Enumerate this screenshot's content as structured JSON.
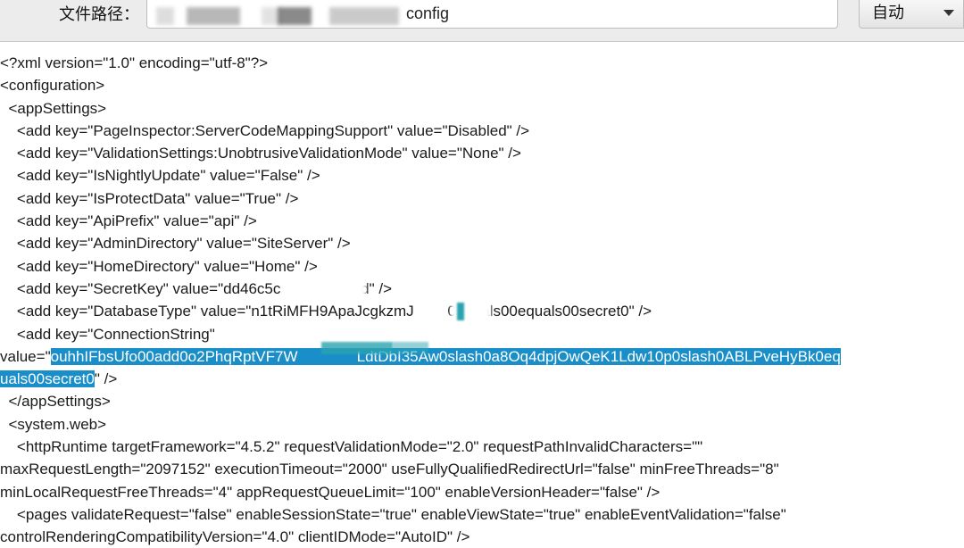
{
  "toolbar": {
    "path_label": "文件路径：",
    "path_value_visible": "config",
    "encoding_value": "自动",
    "chevron_icon": "chevron-down-icon"
  },
  "code_lines": [
    "<?xml version=\"1.0\" encoding=\"utf-8\"?>",
    "<configuration>",
    "  <appSettings>",
    "    <add key=\"PageInspector:ServerCodeMappingSupport\" value=\"Disabled\" />",
    "    <add key=\"ValidationSettings:UnobtrusiveValidationMode\" value=\"None\" />",
    "    <add key=\"IsNightlyUpdate\" value=\"False\" />",
    "    <add key=\"IsProtectData\" value=\"True\" />",
    "    <add key=\"ApiPrefix\" value=\"api\" />",
    "    <add key=\"AdminDirectory\" value=\"SiteServer\" />",
    "    <add key=\"HomeDirectory\" value=\"Home\" />",
    "    <add key=\"SecretKey\" value=\"dd46c5c          36f7dd\" />",
    "    <add key=\"DatabaseType\" value=\"n1tRiMFH9ApaJcgkzmJ        0equals00equals00secret0\" />",
    "    <add key=\"ConnectionString\""
  ],
  "connection": {
    "prefix": "value=\"",
    "highlight_line1": "ouhhIFbsUfo00add0o2PhqRptVF7W              LdtDbI35Aw0slash0a8Oq4dpjOwQeK1Ldw10p0slash0ABLPveHyBk0eq",
    "highlight_line2": "uals00secret0",
    "suffix": "\" />"
  },
  "code_lines_after": [
    "  </appSettings>",
    "  <system.web>",
    "    <httpRuntime targetFramework=\"4.5.2\" requestValidationMode=\"2.0\" requestPathInvalidCharacters=\"\"",
    "maxRequestLength=\"2097152\" executionTimeout=\"2000\" useFullyQualifiedRedirectUrl=\"false\" minFreeThreads=\"8\"",
    "minLocalRequestFreeThreads=\"4\" appRequestQueueLimit=\"100\" enableVersionHeader=\"false\" />",
    "    <pages validateRequest=\"false\" enableSessionState=\"true\" enableViewState=\"true\" enableEventValidation=\"false\"",
    "controlRenderingCompatibilityVersion=\"4.0\" clientIDMode=\"AutoID\" />"
  ],
  "colors": {
    "selection": "#1a8ec9",
    "toolbar_bg": "#ececec"
  }
}
